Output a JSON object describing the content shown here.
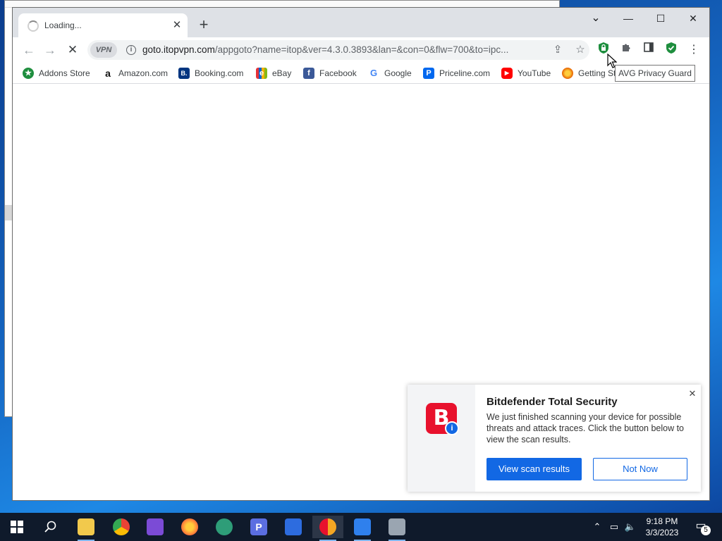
{
  "browser": {
    "tab": {
      "title": "Loading...",
      "close": "✕"
    },
    "new_tab": "+",
    "window_controls": {
      "minimize": "—",
      "maximize": "☐",
      "close": "✕",
      "tab_search": "⌄"
    },
    "address": {
      "vpn_badge": "VPN",
      "host": "goto.itopvpn.com",
      "path": "/appgoto?name=itop&ver=4.3.0.3893&lan=&con=0&flw=700&to=ipc..."
    },
    "tooltip": "AVG Privacy Guard",
    "bookmarks": [
      {
        "label": "Addons Store",
        "icon": "addons-store-icon",
        "icon_glyph": "★",
        "color": "#1e8e3e"
      },
      {
        "label": "Amazon.com",
        "icon": "amazon-icon",
        "icon_glyph": "a",
        "color": "#ffffff"
      },
      {
        "label": "Booking.com",
        "icon": "booking-icon",
        "icon_glyph": "B.",
        "color": "#003580"
      },
      {
        "label": "eBay",
        "icon": "ebay-icon",
        "icon_glyph": "e",
        "color": "#e53238"
      },
      {
        "label": "Facebook",
        "icon": "facebook-icon",
        "icon_glyph": "f",
        "color": "#3b5998"
      },
      {
        "label": "Google",
        "icon": "google-icon",
        "icon_glyph": "G",
        "color": "#ffffff"
      },
      {
        "label": "Priceline.com",
        "icon": "priceline-icon",
        "icon_glyph": "P",
        "color": "#0068ef"
      },
      {
        "label": "YouTube",
        "icon": "youtube-icon",
        "icon_glyph": "▶",
        "color": "#ff0000"
      },
      {
        "label": "Getting St",
        "icon": "firefox-icon",
        "icon_glyph": "●",
        "color": "#e66000"
      }
    ]
  },
  "bitdefender": {
    "logo_letter": "B",
    "badge": "i",
    "title": "Bitdefender Total Security",
    "message": "We just finished scanning your device for possible threats and attack traces. Click the button below to view the scan results.",
    "primary_button": "View scan results",
    "secondary_button": "Not Now",
    "close": "✕",
    "accent": "#1268e4",
    "brand": "#e8112d"
  },
  "taskbar": {
    "apps": [
      {
        "name": "file-explorer-icon",
        "glyph": "▬",
        "color": "#f2c94c"
      },
      {
        "name": "chrome-icon",
        "glyph": "◉",
        "color": "#34a853"
      },
      {
        "name": "visual-studio-icon",
        "glyph": "◆",
        "color": "#7b4bd6"
      },
      {
        "name": "firefox-icon",
        "glyph": "●",
        "color": "#ff7139"
      },
      {
        "name": "vpn-icon",
        "glyph": "◐",
        "color": "#2e9d78"
      },
      {
        "name": "pdf-app-icon",
        "glyph": "P",
        "color": "#5b6ee1"
      },
      {
        "name": "shield-app-icon",
        "glyph": "◆",
        "color": "#2d6cdf"
      },
      {
        "name": "avg-browser-icon",
        "glyph": "◉",
        "color": "#f5a623"
      },
      {
        "name": "document-app-icon",
        "glyph": "▤",
        "color": "#2f80ed"
      },
      {
        "name": "network-app-icon",
        "glyph": "▦",
        "color": "#9aa5b1"
      }
    ],
    "time": "9:18 PM",
    "date": "3/3/2023",
    "notifications": "5"
  }
}
